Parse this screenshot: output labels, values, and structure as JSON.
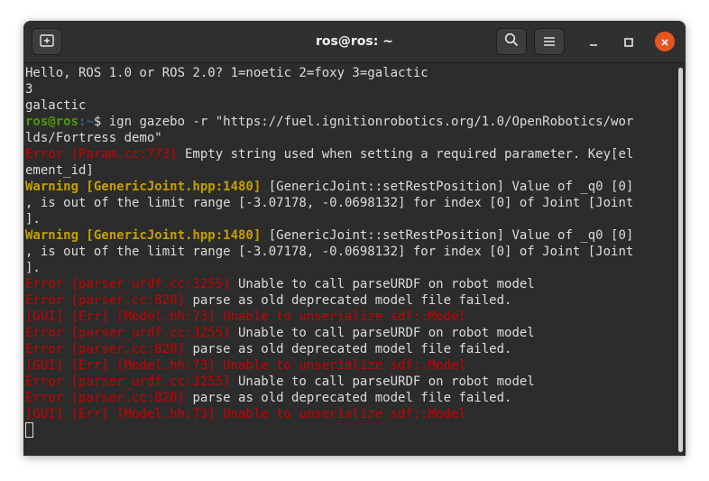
{
  "window": {
    "title": "ros@ros: ~"
  },
  "icons": {
    "new_tab": "new-tab-icon",
    "search": "search-icon",
    "menu": "hamburger-menu-icon",
    "minimize": "minimize-icon",
    "maximize": "maximize-icon",
    "close": "close-icon"
  },
  "colors": {
    "error": "#cc0000",
    "warning": "#c4a000",
    "prompt_user": "#4e9a06",
    "prompt_path": "#3465a4",
    "close_button": "#e95420"
  },
  "terminal": {
    "line1": "Hello, ROS 1.0 or ROS 2.0? 1=noetic 2=foxy 3=galactic",
    "line2": "3",
    "line3": "galactic",
    "prompt_user": "ros@ros",
    "prompt_path": ":~",
    "prompt_symbol": "$ ",
    "command_a": "ign gazebo -r \"https://fuel.ignitionrobotics.org/1.0/OpenRobotics/wor",
    "command_b": "lds/Fortress demo\"",
    "e1_tag": "Error [Param.cc:773]",
    "e1_msg_a": " Empty string used when setting a required parameter. Key[el",
    "e1_msg_b": "ement_id]",
    "w1_tag": "Warning [GenericJoint.hpp:1480]",
    "w1_msg_a": " [GenericJoint::setRestPosition] Value of _q0 [0]",
    "w1_msg_b": ", is out of the limit range [-3.07178, -0.0698132] for index [0] of Joint [Joint",
    "w1_msg_c": "].",
    "w2_tag": "Warning [GenericJoint.hpp:1480]",
    "w2_msg_a": " [GenericJoint::setRestPosition] Value of _q0 [0]",
    "w2_msg_b": ", is out of the limit range [-3.07178, -0.0698132] for index [0] of Joint [Joint",
    "w2_msg_c": "].",
    "urdf_tag": "Error [parser_urdf.cc:3255]",
    "urdf_msg": " Unable to call parseURDF on robot model",
    "parser_tag": "Error [parser.cc:820]",
    "parser_msg": " parse as old deprecated model file failed.",
    "gui_line": "[GUI] [Err] [Model.hh:73] Unable to unserialize sdf::Model"
  }
}
